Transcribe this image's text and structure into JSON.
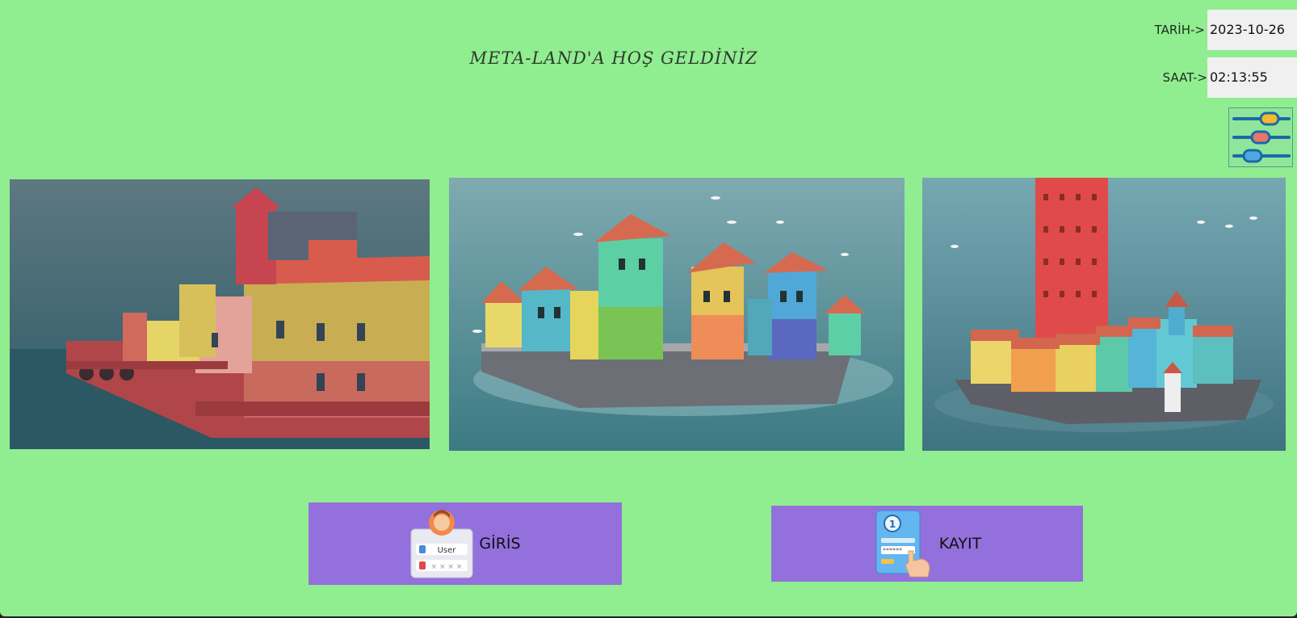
{
  "header": {
    "title": "META-LAND'A HOŞ GELDİNİZ"
  },
  "datetime": {
    "date_label": "TARİH->",
    "date_value": "2023-10-26",
    "time_label": "SAAT->",
    "time_value": "02:13:55"
  },
  "settings": {
    "icon": "sliders-icon"
  },
  "gallery": [
    {
      "name": "town-image-1",
      "icon": "harbor-town-render"
    },
    {
      "name": "town-image-2",
      "icon": "island-village-render"
    },
    {
      "name": "town-image-3",
      "icon": "tower-island-render"
    }
  ],
  "buttons": {
    "login_label": "GİRİS",
    "login_icon": "user-login-icon",
    "login_icon_text": "User",
    "login_icon_password": "× × × ×",
    "register_label": "KAYIT",
    "register_icon": "register-form-icon",
    "register_icon_password": "******"
  },
  "colors": {
    "background": "#90ee90",
    "button": "#9370db",
    "value_box": "#f0f0f0"
  }
}
